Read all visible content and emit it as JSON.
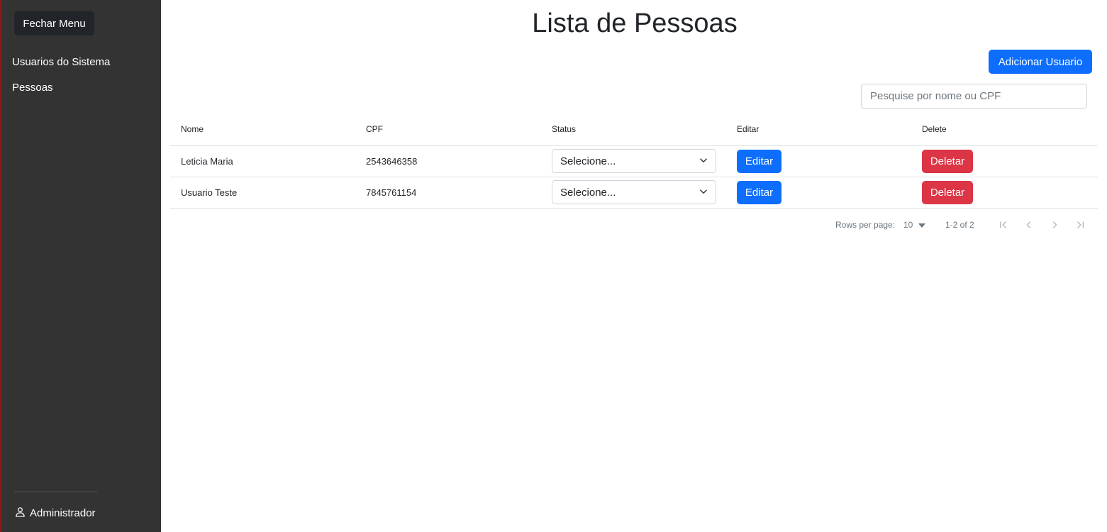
{
  "sidebar": {
    "close_button": "Fechar Menu",
    "items": [
      {
        "label": "Usuarios do Sistema"
      },
      {
        "label": "Pessoas"
      }
    ],
    "user": {
      "name": "Administrador",
      "icon": "user-icon"
    }
  },
  "main": {
    "title": "Lista de Pessoas",
    "add_button": "Adicionar Usuario",
    "search": {
      "placeholder": "Pesquise por nome ou CPF",
      "value": ""
    }
  },
  "table": {
    "headers": [
      "Nome",
      "CPF",
      "Status",
      "Editar",
      "Delete"
    ],
    "rows": [
      {
        "nome": "Leticia Maria",
        "cpf": "2543646358",
        "status": "Selecione...",
        "edit": "Editar",
        "delete": "Deletar"
      },
      {
        "nome": "Usuario Teste",
        "cpf": "7845761154",
        "status": "Selecione...",
        "edit": "Editar",
        "delete": "Deletar"
      }
    ]
  },
  "pagination": {
    "rows_per_page_label": "Rows per page:",
    "rows_per_page": "10",
    "range": "1-2 of 2"
  },
  "colors": {
    "sidebar_bg": "#333333",
    "primary": "#0d6efd",
    "danger": "#dc3545",
    "dark_button": "#212529"
  }
}
